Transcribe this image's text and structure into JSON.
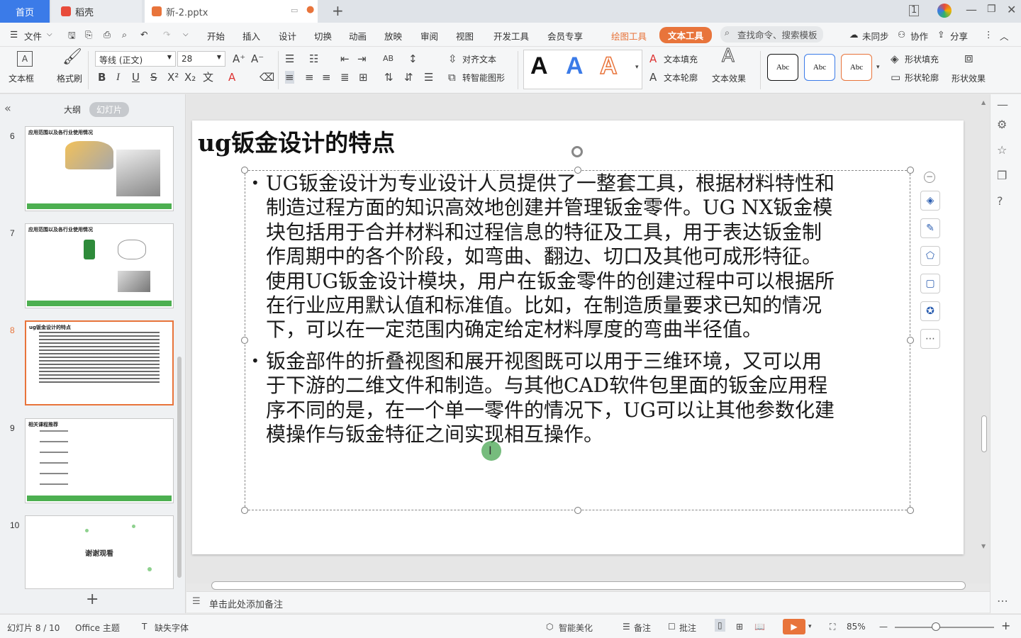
{
  "tabs": {
    "home": "首页",
    "daoke": "稻壳",
    "doc": "新-2.pptx"
  },
  "menu": {
    "file": "文件",
    "items": [
      "开始",
      "插入",
      "设计",
      "切换",
      "动画",
      "放映",
      "审阅",
      "视图",
      "开发工具",
      "会员专享"
    ],
    "drawing_tools": "绘图工具",
    "text_tools": "文本工具",
    "search": "查找命令、搜索模板",
    "unsynced": "未同步",
    "collab": "协作",
    "share": "分享"
  },
  "ribbon": {
    "textbox": "文本框",
    "format_painter": "格式刷",
    "font_name": "等线 (正文)",
    "font_size": "28",
    "align_text": "对齐文本",
    "smartart": "转智能图形",
    "text_fill": "文本填充",
    "text_outline": "文本轮廓",
    "text_effect": "文本效果",
    "abc": "Abc",
    "shape_fill": "形状填充",
    "shape_outline": "形状轮廓",
    "shape_effect": "形状效果"
  },
  "panel": {
    "outline": "大纲",
    "slides": "幻灯片",
    "thumbs": [
      {
        "num": "6",
        "title": "应用范围以及各行业使用情况"
      },
      {
        "num": "7",
        "title": "应用范围以及各行业使用情况"
      },
      {
        "num": "8",
        "title": "ug钣金设计的特点"
      },
      {
        "num": "9",
        "title": "相关课程推荐"
      },
      {
        "num": "10",
        "title": "谢谢观看"
      }
    ]
  },
  "slide": {
    "title": "ug钣金设计的特点",
    "bullets": [
      [
        "UG钣金设计为专业设计人员提供了一整套工具，根据材料特性和",
        "制造过程方面的知识高效地创建并管理钣金零件。UG NX钣金模",
        "块包括用于合并材料和过程信息的特征及工具，用于表达钣金制",
        "作周期中的各个阶段，如弯曲、翻边、切口及其他可成形特征。",
        "使用UG钣金设计模块，用户在钣金零件的创建过程中可以根据所",
        "在行业应用默认值和标准值。比如，在制造质量要求已知的情况",
        "下，可以在一定范围内确定给定材料厚度的弯曲半径值。"
      ],
      [
        "钣金部件的折叠视图和展开视图既可以用于三维环境，又可以用",
        "于下游的二维文件和制造。与其他CAD软件包里面的钣金应用程",
        "序不同的是，在一个单一零件的情况下，UG可以让其他参数化建",
        "模操作与钣金特征之间实现相互操作。"
      ]
    ]
  },
  "notes": "单击此处添加备注",
  "status": {
    "slide_pos": "幻灯片 8 / 10",
    "theme": "Office 主题",
    "missing_font": "缺失字体",
    "beautify": "智能美化",
    "notes_btn": "备注",
    "comments": "批注",
    "zoom": "85%"
  },
  "colors": {
    "accent": "#3b7be8",
    "text_tools": "#e8743b",
    "green": "#4caf50"
  }
}
